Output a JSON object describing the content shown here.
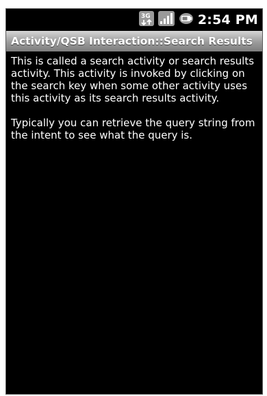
{
  "status_bar": {
    "network_icon": "3g-data-icon",
    "signal_icon": "signal-strength-icon",
    "battery_icon": "battery-icon",
    "time": "2:54 PM"
  },
  "title_bar": {
    "title": "Activity/QSB Interaction::Search Results"
  },
  "content": {
    "paragraph_1": "This is called a search activity or search results activity. This activity is invoked by clicking on the search key when some other activity uses this activity as its search results activity.",
    "paragraph_2": " Typically you can retrieve the query string from the intent to see what the query is."
  }
}
